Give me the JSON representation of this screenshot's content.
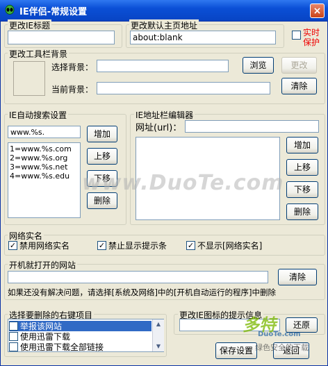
{
  "window": {
    "title": "IE伴侣-常规设置",
    "close": "×"
  },
  "groups": {
    "ie_title": "更改IE标题",
    "home_page": "更改默认主页地址",
    "toolbar_bg": "更改工具栏背景",
    "auto_search": "IE自动搜索设置",
    "addr_editor": "IE地址栏编辑器",
    "realname": "网络实名",
    "startup": "开机就打开的网站",
    "context_menu": "选择要删除的右键项目",
    "ie_icon_tip": "更改IE图标的提示信息"
  },
  "ie_title_value": "",
  "home_page_value": "about:blank",
  "realtime_protect": {
    "label_line1": "实时",
    "label_line2": "保护",
    "checked": false
  },
  "toolbar_bg": {
    "select_label": "选择背景：",
    "current_label": "当前背景：",
    "select_value": "",
    "current_value": "",
    "browse_btn": "浏览",
    "change_btn": "更改",
    "clear_btn": "清除"
  },
  "auto_search": {
    "input_value": "www.%s.",
    "items": [
      "1=www.%s.com",
      "2=www.%s.org",
      "3=www.%s.net",
      "4=www.%s.edu"
    ],
    "add_btn": "增加",
    "up_btn": "上移",
    "down_btn": "下移",
    "delete_btn": "删除"
  },
  "addr_editor": {
    "url_label": "网址(url)：",
    "url_value": "",
    "add_btn": "增加",
    "up_btn": "上移",
    "down_btn": "下移",
    "delete_btn": "删除"
  },
  "realname": {
    "opt1": "禁用网络实名",
    "opt2": "禁止显示提示条",
    "opt3": "不显示[网络实名]"
  },
  "startup": {
    "value": "",
    "clear_btn": "清除",
    "note": "如果还没有解决问题，请选择[系统及网络]中的[开机自动运行的程序]中删除"
  },
  "context_menu": {
    "items": [
      "举报该网站",
      "使用迅雷下载",
      "使用迅雷下载全部链接"
    ]
  },
  "ie_icon_tip": {
    "value": "",
    "restore_btn": "还原"
  },
  "footer": {
    "save_btn": "保存设置",
    "back_btn": "返回"
  },
  "watermark": {
    "main": "www.DuoTe.com",
    "corner_big": "多特",
    "corner_site": "DuoTe.com",
    "corner_slogan": "绿色安全的下载"
  }
}
